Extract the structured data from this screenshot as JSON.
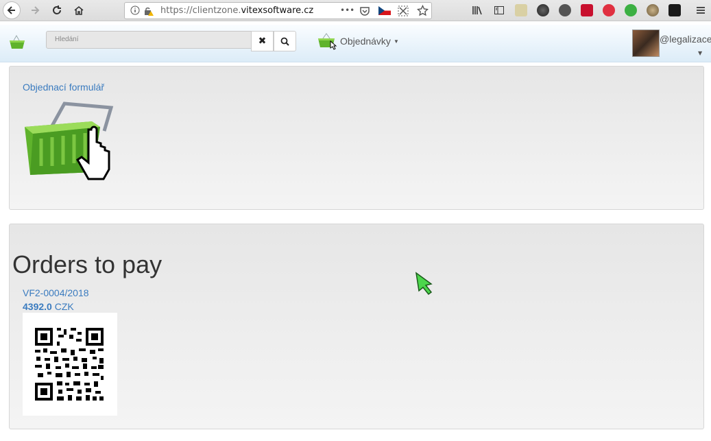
{
  "browser": {
    "url_prefix": "https://clientzone.",
    "url_domain": "vitexsoftware.cz",
    "more_label": "•••"
  },
  "navbar": {
    "search_placeholder": "Hledání",
    "clear_icon": "✖",
    "search_icon": "🔍",
    "orders_label": "Objednávky",
    "user_name": "@legalizace"
  },
  "order_panel": {
    "link": "Objednací formulář"
  },
  "pay_panel": {
    "title": "Orders to pay",
    "invoice": "VF2-0004/2018",
    "amount": "4392.0",
    "currency": "CZK"
  }
}
